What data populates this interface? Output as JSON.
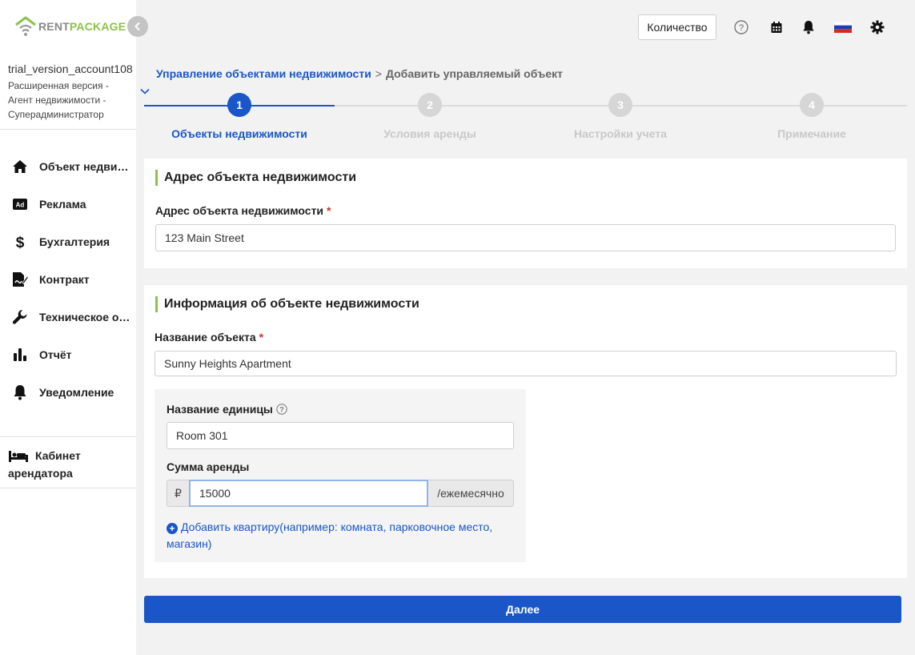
{
  "brand": {
    "part1": "RENT",
    "part2": "PACKAGE",
    "accent_color": "#8bc34a",
    "primary_color": "#1a56c8"
  },
  "account": {
    "username": "trial_version_account108",
    "roles": [
      "Расширенная версия -",
      "Агент недвижимости -",
      "Суперадминистратор"
    ]
  },
  "sidebar": {
    "items": [
      {
        "label": "Объект недвижимости",
        "icon": "home-icon"
      },
      {
        "label": "Реклама",
        "icon": "ad-icon"
      },
      {
        "label": "Бухгалтерия",
        "icon": "dollar-icon"
      },
      {
        "label": "Контракт",
        "icon": "contract-icon"
      },
      {
        "label": "Техническое обслуживание",
        "icon": "wrench-icon"
      },
      {
        "label": "Отчёт",
        "icon": "chart-icon"
      },
      {
        "label": "Уведомление",
        "icon": "bell-icon"
      }
    ],
    "tenant_cabinet": "Кабинет арендатора"
  },
  "topbar": {
    "quantity_button": "Количество",
    "language": "ru"
  },
  "breadcrumb": {
    "parent": "Управление объектами недвижимости",
    "separator": ">",
    "current": "Добавить управляемый объект"
  },
  "stepper": {
    "steps": [
      {
        "number": "1",
        "label": "Объекты недвижимости",
        "active": true
      },
      {
        "number": "2",
        "label": "Условия аренды",
        "active": false
      },
      {
        "number": "3",
        "label": "Настройки учета",
        "active": false
      },
      {
        "number": "4",
        "label": "Примечание",
        "active": false
      }
    ]
  },
  "address_card": {
    "title": "Адрес объекта недвижимости",
    "field_label": "Адрес объекта недвижимости",
    "required_mark": "*",
    "value": "123 Main Street"
  },
  "info_card": {
    "title": "Информация об объекте недвижимости",
    "name_label": "Название объекта",
    "required_mark": "*",
    "name_value": "Sunny Heights Apartment",
    "unit": {
      "unit_name_label": "Название единицы",
      "unit_name_value": "Room 301",
      "rent_label": "Сумма аренды",
      "currency": "₽",
      "rent_value": "15000",
      "period": "/ежемесячно",
      "add_link": "Добавить квартиру(например: комната, парковочное место, магазин)"
    }
  },
  "next_button": "Далее"
}
